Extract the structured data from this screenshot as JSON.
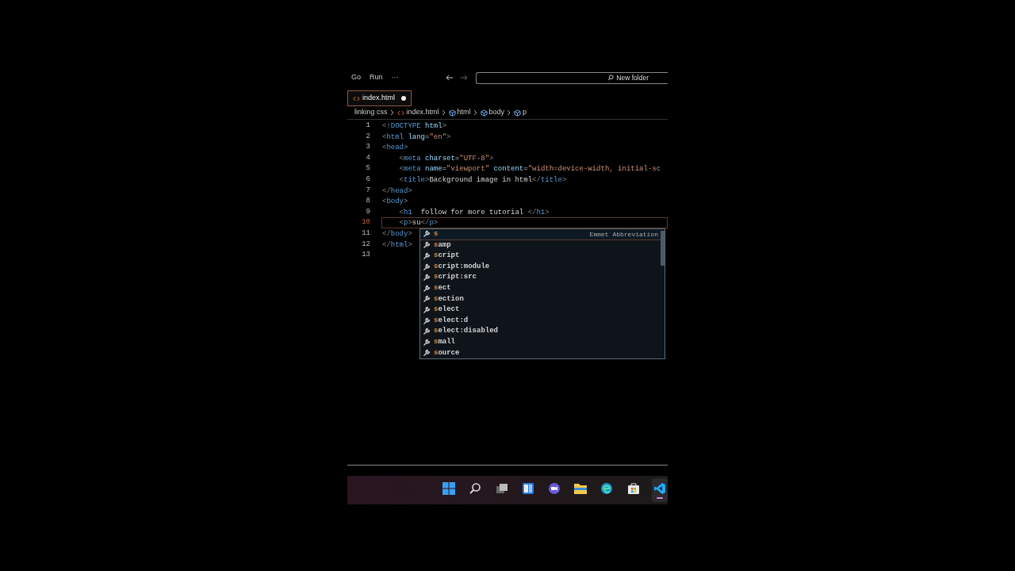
{
  "menu": [
    "Go",
    "Run",
    "···"
  ],
  "search": {
    "value": "New folder"
  },
  "tabs": [
    {
      "label": "index.html",
      "selected": true,
      "modified": true
    }
  ],
  "breadcrumb": [
    {
      "kind": "folder",
      "label": "linking css"
    },
    {
      "kind": "file",
      "label": "index.html"
    },
    {
      "kind": "element",
      "label": "html"
    },
    {
      "kind": "element",
      "label": "body"
    },
    {
      "kind": "element",
      "label": "p"
    }
  ],
  "code": [
    {
      "number": "1",
      "current": false,
      "tokens": [
        {
          "kind": "punct",
          "text": "<!"
        },
        {
          "kind": "tag",
          "text": "DOCTYPE"
        },
        {
          "kind": "attr",
          "text": " html"
        },
        {
          "kind": "punct",
          "text": ">"
        }
      ]
    },
    {
      "number": "2",
      "current": false,
      "tokens": [
        {
          "kind": "punct",
          "text": "<"
        },
        {
          "kind": "tag",
          "text": "html"
        },
        {
          "kind": "attr",
          "text": " lang"
        },
        {
          "kind": "text",
          "text": "="
        },
        {
          "kind": "string",
          "text": "\"en\""
        },
        {
          "kind": "punct",
          "text": ">"
        }
      ]
    },
    {
      "number": "3",
      "current": false,
      "tokens": [
        {
          "kind": "punct",
          "text": "<"
        },
        {
          "kind": "tag",
          "text": "head"
        },
        {
          "kind": "punct",
          "text": ">"
        }
      ]
    },
    {
      "number": "4",
      "current": false,
      "tokens": [
        {
          "kind": "punct",
          "text": "    <"
        },
        {
          "kind": "tag",
          "text": "meta"
        },
        {
          "kind": "attr",
          "text": " charset"
        },
        {
          "kind": "text",
          "text": "="
        },
        {
          "kind": "string",
          "text": "\"UTF-8\""
        },
        {
          "kind": "punct",
          "text": ">"
        }
      ]
    },
    {
      "number": "5",
      "current": false,
      "tokens": [
        {
          "kind": "punct",
          "text": "    <"
        },
        {
          "kind": "tag",
          "text": "meta"
        },
        {
          "kind": "attr",
          "text": " name"
        },
        {
          "kind": "text",
          "text": "="
        },
        {
          "kind": "string",
          "text": "\"viewport\""
        },
        {
          "kind": "attr",
          "text": " content"
        },
        {
          "kind": "text",
          "text": "="
        },
        {
          "kind": "string",
          "text": "\"width=device-width, initial-sc"
        }
      ]
    },
    {
      "number": "6",
      "current": false,
      "tokens": [
        {
          "kind": "punct",
          "text": "    <"
        },
        {
          "kind": "tag",
          "text": "title"
        },
        {
          "kind": "punct",
          "text": ">"
        },
        {
          "kind": "text",
          "text": "Background image in html"
        },
        {
          "kind": "punct",
          "text": "</"
        },
        {
          "kind": "tag",
          "text": "title"
        },
        {
          "kind": "punct",
          "text": ">"
        }
      ]
    },
    {
      "number": "7",
      "current": false,
      "tokens": [
        {
          "kind": "punct",
          "text": "</"
        },
        {
          "kind": "tag",
          "text": "head"
        },
        {
          "kind": "punct",
          "text": ">"
        }
      ]
    },
    {
      "number": "8",
      "current": false,
      "tokens": [
        {
          "kind": "punct",
          "text": "<"
        },
        {
          "kind": "tag",
          "text": "body"
        },
        {
          "kind": "punct",
          "text": ">"
        }
      ]
    },
    {
      "number": "9",
      "current": false,
      "tokens": [
        {
          "kind": "punct",
          "text": "    <"
        },
        {
          "kind": "tag",
          "text": "h1"
        },
        {
          "kind": "text",
          "text": "  follow for more tutorial "
        },
        {
          "kind": "punct",
          "text": "</"
        },
        {
          "kind": "tag",
          "text": "h1"
        },
        {
          "kind": "punct",
          "text": ">"
        }
      ]
    },
    {
      "number": "10",
      "current": true,
      "tokens": [
        {
          "kind": "punct",
          "text": "    <"
        },
        {
          "kind": "tag",
          "text": "p"
        },
        {
          "kind": "punct",
          "text": ">"
        },
        {
          "kind": "text",
          "text": "su"
        },
        {
          "kind": "punct",
          "text": "</"
        },
        {
          "kind": "tag",
          "text": "p"
        },
        {
          "kind": "punct",
          "text": ">"
        }
      ]
    },
    {
      "number": "11",
      "current": false,
      "tokens": [
        {
          "kind": "punct",
          "text": "</"
        },
        {
          "kind": "tag",
          "text": "body"
        },
        {
          "kind": "punct",
          "text": ">"
        }
      ]
    },
    {
      "number": "12",
      "current": false,
      "tokens": [
        {
          "kind": "punct",
          "text": "</"
        },
        {
          "kind": "tag",
          "text": "html"
        },
        {
          "kind": "punct",
          "text": ">"
        }
      ]
    },
    {
      "number": "13",
      "current": false
    }
  ],
  "suggestions": {
    "detail": "Emmet Abbreviation",
    "items": [
      {
        "match": "s",
        "selected": true
      },
      {
        "match": "s",
        "rest": "amp",
        "selected": false
      },
      {
        "match": "s",
        "rest": "cript",
        "selected": false
      },
      {
        "match": "s",
        "rest": "cript:module",
        "selected": false
      },
      {
        "match": "s",
        "rest": "cript:src",
        "selected": false
      },
      {
        "match": "s",
        "rest": "ect",
        "selected": false
      },
      {
        "match": "s",
        "rest": "ection",
        "selected": false
      },
      {
        "match": "s",
        "rest": "elect",
        "selected": false
      },
      {
        "match": "s",
        "rest": "elect:d",
        "selected": false
      },
      {
        "match": "s",
        "rest": "elect:disabled",
        "selected": false
      },
      {
        "match": "s",
        "rest": "mall",
        "selected": false
      },
      {
        "match": "s",
        "rest": "ource",
        "selected": false
      }
    ]
  },
  "taskbar": [
    {
      "kind": "start",
      "active": false
    },
    {
      "kind": "search",
      "active": false
    },
    {
      "kind": "taskview",
      "active": false
    },
    {
      "kind": "widgets",
      "active": false
    },
    {
      "kind": "chat",
      "active": false
    },
    {
      "kind": "folder",
      "active": false
    },
    {
      "kind": "browser",
      "active": false
    },
    {
      "kind": "store",
      "active": false
    },
    {
      "kind": "editor",
      "active": true
    }
  ]
}
